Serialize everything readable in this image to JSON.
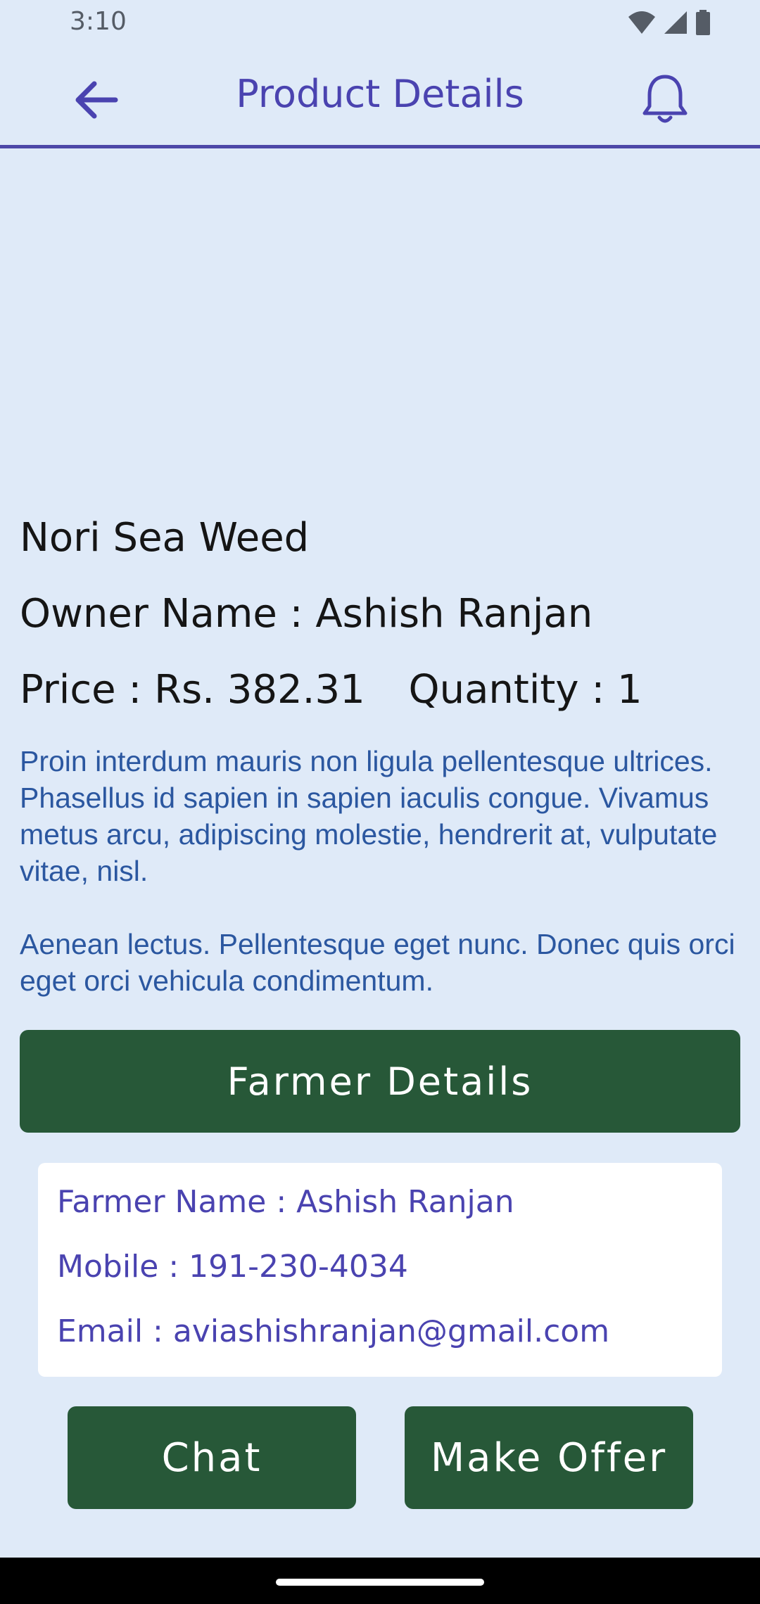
{
  "status_bar": {
    "time": "3:10",
    "icons": [
      "wifi-icon",
      "cell-signal-icon",
      "battery-icon"
    ]
  },
  "app_bar": {
    "title": "Product Details",
    "back_icon": "arrow-left-icon",
    "notification_icon": "bell-icon"
  },
  "product": {
    "name": "Nori Sea Weed",
    "owner_line": "Owner Name : Ashish Ranjan",
    "price_line": "Price : Rs. 382.31",
    "quantity_line": "Quantity : 1",
    "description_paragraphs": [
      "Proin interdum mauris non ligula pellentesque ultrices. Phasellus id sapien in sapien iaculis congue. Vivamus metus arcu, adipiscing molestie, hendrerit at, vulputate vitae, nisl.",
      "Aenean lectus. Pellentesque eget nunc. Donec quis orci eget orci vehicula condimentum."
    ]
  },
  "farmer_section": {
    "button_label": "Farmer Details",
    "name_line": "Farmer Name : Ashish Ranjan",
    "mobile_line": "Mobile : 191-230-4034",
    "email_line": "Email : aviashishranjan@gmail.com"
  },
  "actions": {
    "chat_label": "Chat",
    "offer_label": "Make Offer"
  },
  "colors": {
    "background": "#dfeaf8",
    "accent": "#4a43b0",
    "button": "#275838",
    "description": "#2b57a0"
  }
}
